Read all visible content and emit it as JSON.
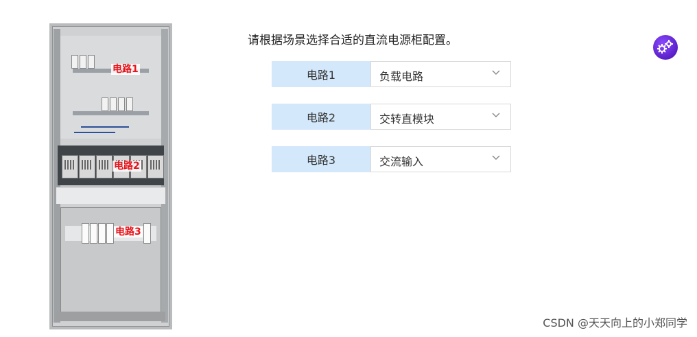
{
  "question": "请根据场景选择合适的直流电源柜配置。",
  "image": {
    "labels": [
      "电路1",
      "电路2",
      "电路3"
    ]
  },
  "rows": [
    {
      "label": "电路1",
      "value": "负载电路"
    },
    {
      "label": "电路2",
      "value": "交转直模块"
    },
    {
      "label": "电路3",
      "value": "交流输入"
    }
  ],
  "icons": {
    "dropdown": "chevron-down-icon",
    "settings": "gear-icon"
  },
  "colors": {
    "label_bg": "#d3e8fb",
    "circuit_label": "#e8141b",
    "gear": "#5a1fc8"
  },
  "watermark": "CSDN @天天向上的小郑同学"
}
